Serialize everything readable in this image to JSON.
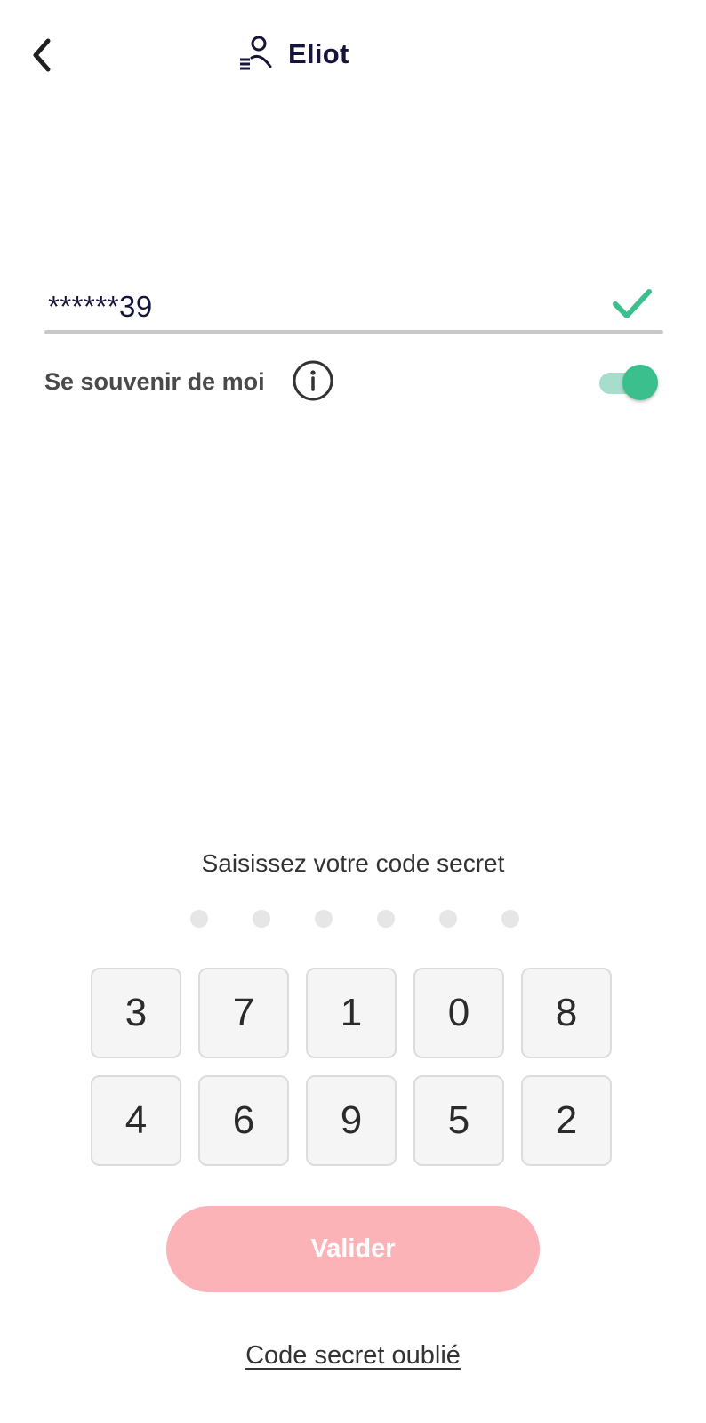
{
  "header": {
    "back_icon": "chevron-left-icon",
    "user_icon": "user-list-icon",
    "title": "Eliot"
  },
  "login": {
    "masked_id": "******39",
    "valid_icon": "check-icon",
    "remember_label": "Se souvenir de moi",
    "info_icon": "info-icon",
    "remember_enabled": true
  },
  "pin": {
    "prompt": "Saisissez votre code secret",
    "digits_total": 6,
    "digits_entered": 0,
    "keypad_rows": [
      [
        "3",
        "7",
        "1",
        "0",
        "8"
      ],
      [
        "4",
        "6",
        "9",
        "5",
        "2"
      ]
    ]
  },
  "actions": {
    "validate_label": "Valider",
    "forgot_label": "Code secret oublié"
  },
  "colors": {
    "primary_text": "#141539",
    "success": "#3bbf8c",
    "toggle_track": "#a7ddcc",
    "validate_disabled": "#fbb3b8",
    "pin_dot": "#e6e6e6",
    "key_bg": "#f5f5f5"
  }
}
